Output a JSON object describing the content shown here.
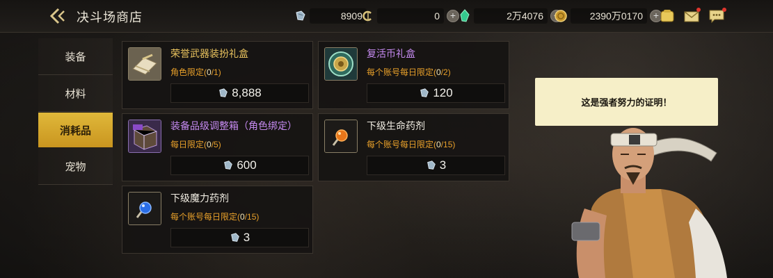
{
  "header": {
    "title": "决斗场商店",
    "currencies": [
      {
        "icon": "crystal-ticket-icon",
        "value": "8909",
        "has_plus": false
      },
      {
        "icon": "c-coin-icon",
        "value": "0",
        "has_plus": true
      },
      {
        "icon": "green-gem-icon",
        "value": "2万4076",
        "has_plus": true
      },
      {
        "icon": "gold-coin-icon",
        "value": "2390万0170",
        "has_plus": true
      }
    ],
    "plus_label": "+"
  },
  "sidebar": {
    "items": [
      {
        "label": "装备",
        "active": false
      },
      {
        "label": "材料",
        "active": false
      },
      {
        "label": "消耗品",
        "active": true
      },
      {
        "label": "宠物",
        "active": false
      }
    ]
  },
  "items": [
    {
      "name": "荣誉武器装扮礼盒",
      "limit_prefix": "角色限定(",
      "limit_used": "0",
      "limit_total": "/1)",
      "price": "8,888",
      "icon": "weapon-giftbox-icon",
      "name_color": "gold"
    },
    {
      "name": "复活币礼盒",
      "limit_prefix": "每个账号每日限定(",
      "limit_used": "0",
      "limit_total": "/2)",
      "price": "120",
      "icon": "revive-coin-box-icon",
      "name_color": "purple"
    },
    {
      "name": "装备品级调整箱（角色绑定）",
      "limit_prefix": "每日限定(",
      "limit_used": "0",
      "limit_total": "/5)",
      "price": "600",
      "icon": "grade-adjust-box-icon",
      "name_color": "purple"
    },
    {
      "name": "下级生命药剂",
      "limit_prefix": "每个账号每日限定(",
      "limit_used": "0",
      "limit_total": "/15)",
      "price": "3",
      "icon": "hp-potion-icon",
      "name_color": "white"
    },
    {
      "name": "下级魔力药剂",
      "limit_prefix": "每个账号每日限定(",
      "limit_used": "0",
      "limit_total": "/15)",
      "price": "3",
      "icon": "mp-potion-icon",
      "name_color": "white"
    }
  ],
  "npc": {
    "speech": "这是强者努力的证明！"
  },
  "colors": {
    "accent_gold": "#e0b83a",
    "limit_orange": "#e8a02a",
    "name_purple": "#c58af0"
  }
}
